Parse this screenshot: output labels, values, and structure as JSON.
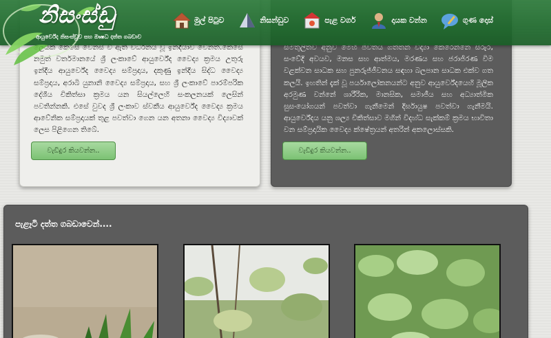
{
  "header": {
    "logo_text": "නිසංස්ඩු",
    "tagline": "ආයුර්වේද නිසංස්ඩුව සහ ඖෂධ දත්ත ගබඩාව",
    "nav": [
      {
        "label": "මුල් පිටුව",
        "icon": "home-icon"
      },
      {
        "label": "නිසන්ඩුව",
        "icon": "pyramid-icon"
      },
      {
        "label": "පැළ වර්ග",
        "icon": "plant-house-icon"
      },
      {
        "label": "දායක වන්න",
        "icon": "user-icon"
      },
      {
        "label": "ගුණ දොස්",
        "icon": "comment-icon"
      }
    ]
  },
  "cards": {
    "left": {
      "text": "ලෙයක් කෙසේ වෙනස් වී ඇති වර්ධනය වූ ඉන්දියාව වෙනත්.කෙසේ නමුත් වර්තමානයේ ශ්‍රී ලංකාවේ ආයුර්වේද වෛද්‍ය ක්‍රමය උතුරු ඉන්දීය ආයුර්වේද වෛද්‍ය සම්ප්‍රදාය, දකුණු ඉන්දීය සිද්ධ වෛද්‍ය සම්ප්‍රදාය, අරාබි යුනානි වෛද්‍ය සම්ප්‍රදාය, සහ ශ්‍රී ලංකාවේ පාරම්පරික දේශීය චිකිත්සා ක්‍රමය යන සියල්ලෙහි සංකලනයක් ලෙසින් පවතින්නකි. එසේ වුවද ශ්‍රී ලංකාව ස්වකීය ආයුර්වේද වෛද්‍ය ක්‍රමය ආවේනික සම්ප්‍රදායක් තුළ පවත්වා ගෙන යන අතනා වෛද්‍ය විද්‍යාවක් ලෙස පිළිගෙන තිබේ.",
      "button": "වැඩිදුර කියවන්න.."
    },
    "right": {
      "text": "සමතුලිතව අනුව මෙහි ජීවිතය ගත්තන් විද්‍යා කෙරෙන්නෙ සිරුර, සංවේදි අවයව, මනස සහ ආත්මය, මරණය සහ ජරාජිරණ විම වළක්වන සාධක සහ පුනරුජ්ජීවනය සඳහා බලපාන සාධක එක්ව ගත කලයි. ඉහතින් දැක් වූ පර්යාලෝකනයන්ට අනුව ආයුර්වේදයෙහි මූලික අරමුණ වන්නේ ශාරීරික, මානසික, සමාජීය සහ අධ්‍යාත්මික සුසංයෝගයන් පවත්වා ගැනීමෙන් දිර්ඝායුෂ පවත්වා ගැනීමයි. ආයුර්වේදය යනු ශල්‍ය චිකිත්සාව මගින් විදහ්ධ සැක්කම් ක්‍රමය භාවිතා වන සම්ප්‍රදායික වෛද්‍ය ක්ෂේත්‍රයන් අතරින් අකලොස්සකි.",
      "button": "වැඩිදුර කියවන්න.."
    }
  },
  "gallery": {
    "title": "පැළෑටි දත්ත ගබඩාවෙන්....",
    "images": [
      "plant-photo-1",
      "plant-photo-2",
      "plant-photo-3"
    ]
  },
  "colors": {
    "header_green": "#1f6a2d",
    "button_green": "#7cc274",
    "dark_panel": "#5c5c5c"
  }
}
